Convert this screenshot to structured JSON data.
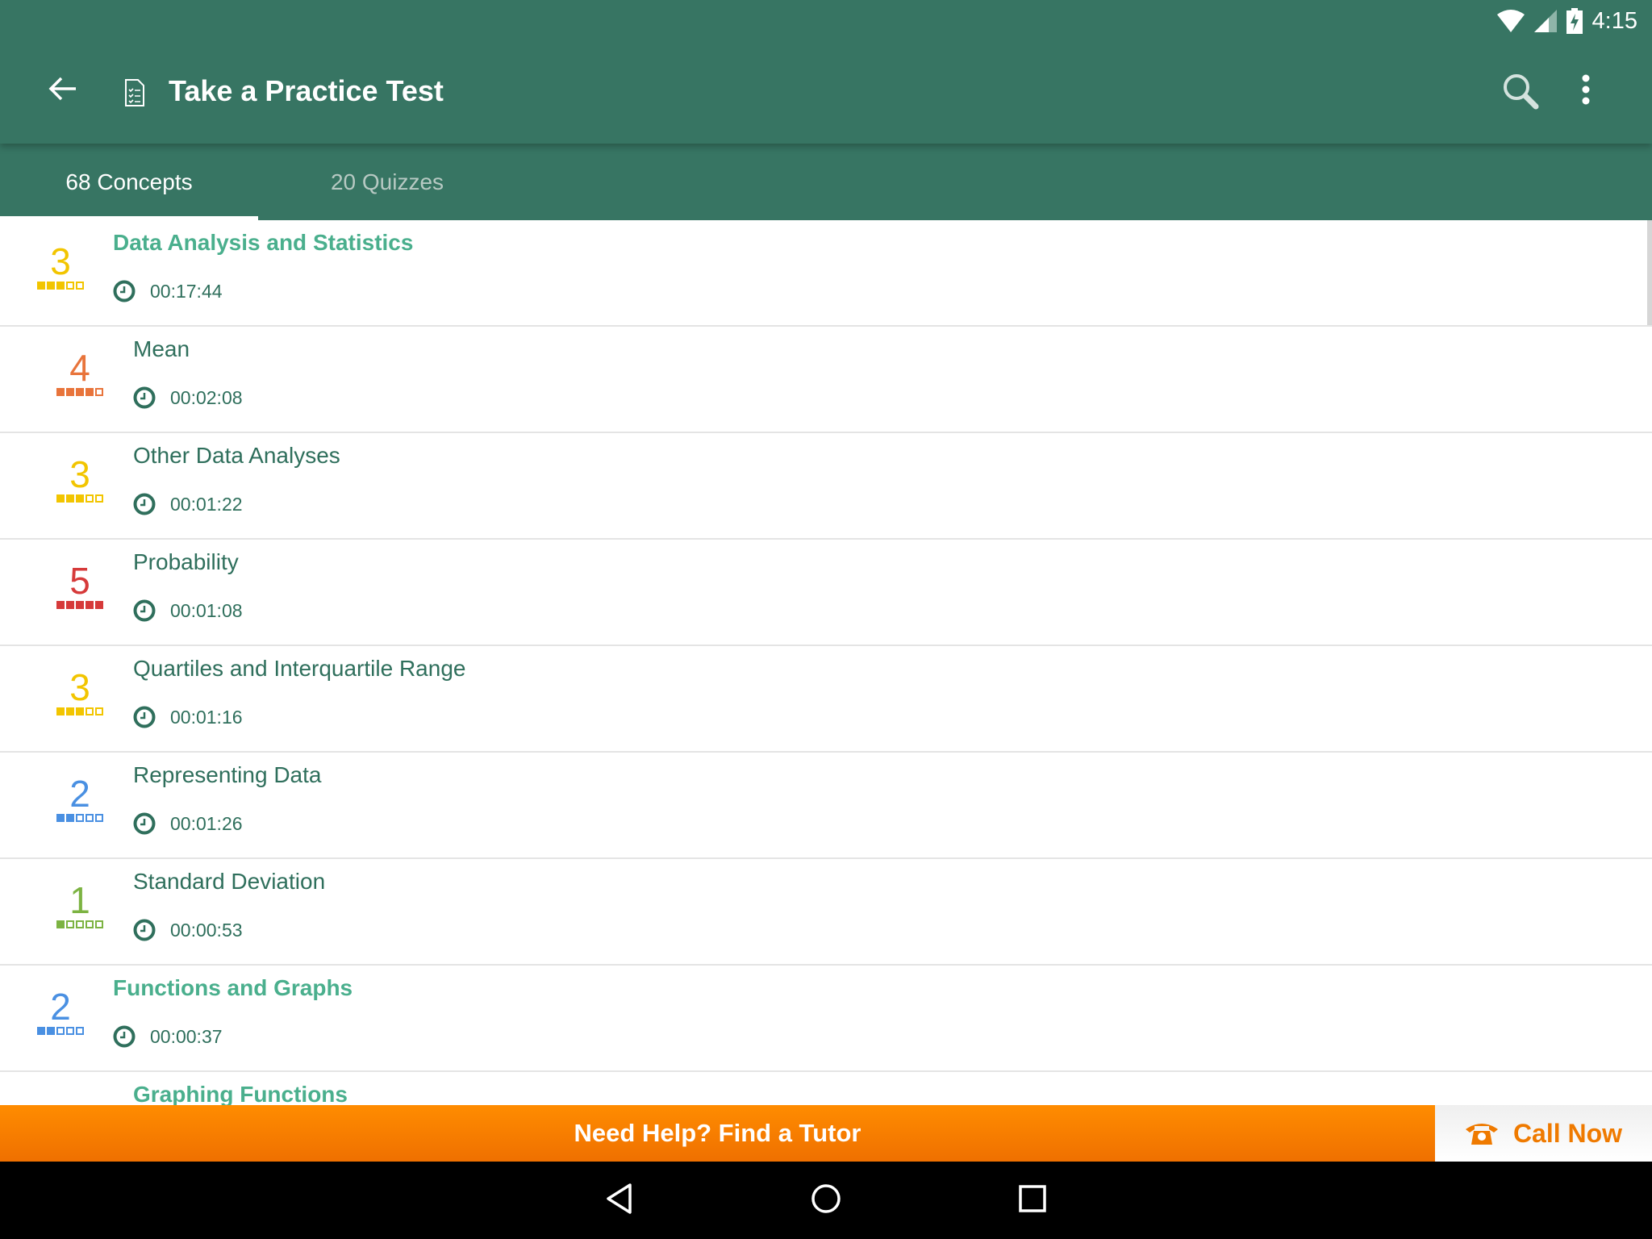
{
  "status_bar": {
    "time": "4:15",
    "icons": [
      "wifi-icon",
      "signal-icon",
      "battery-charging-icon"
    ]
  },
  "app_bar": {
    "title": "Take a Practice Test",
    "icons": [
      "back-arrow-icon",
      "checklist-document-icon",
      "search-icon",
      "more-vert-icon"
    ]
  },
  "tabs": [
    {
      "label": "68 Concepts",
      "active": true
    },
    {
      "label": "20 Quizzes",
      "active": false
    }
  ],
  "level_colors": {
    "1": "#7cb342",
    "2": "#4a90e2",
    "3": "#f2c500",
    "4": "#e8743b",
    "5": "#d63a3a"
  },
  "theme": {
    "primary": "#377563",
    "accent": "#4aaf8d",
    "orange": "#ff8c00"
  },
  "rows": [
    {
      "title": "Data Analysis and Statistics",
      "section": true,
      "level": 3,
      "time": "00:17:44"
    },
    {
      "title": "Mean",
      "section": false,
      "level": 4,
      "time": "00:02:08"
    },
    {
      "title": "Other Data Analyses",
      "section": false,
      "level": 3,
      "time": "00:01:22"
    },
    {
      "title": "Probability",
      "section": false,
      "level": 5,
      "time": "00:01:08"
    },
    {
      "title": "Quartiles and Interquartile Range",
      "section": false,
      "level": 3,
      "time": "00:01:16"
    },
    {
      "title": "Representing Data",
      "section": false,
      "level": 2,
      "time": "00:01:26"
    },
    {
      "title": "Standard Deviation",
      "section": false,
      "level": 1,
      "time": "00:00:53"
    },
    {
      "title": "Functions and Graphs",
      "section": true,
      "level": 2,
      "time": "00:00:37"
    },
    {
      "title": "Graphing Functions",
      "section": true,
      "indented": true
    }
  ],
  "bottom_bar": {
    "help_label": "Need Help? Find a Tutor",
    "call_label": "Call Now"
  },
  "nav_bar": {
    "icons": [
      "back-triangle-icon",
      "home-circle-icon",
      "recents-square-icon"
    ]
  }
}
